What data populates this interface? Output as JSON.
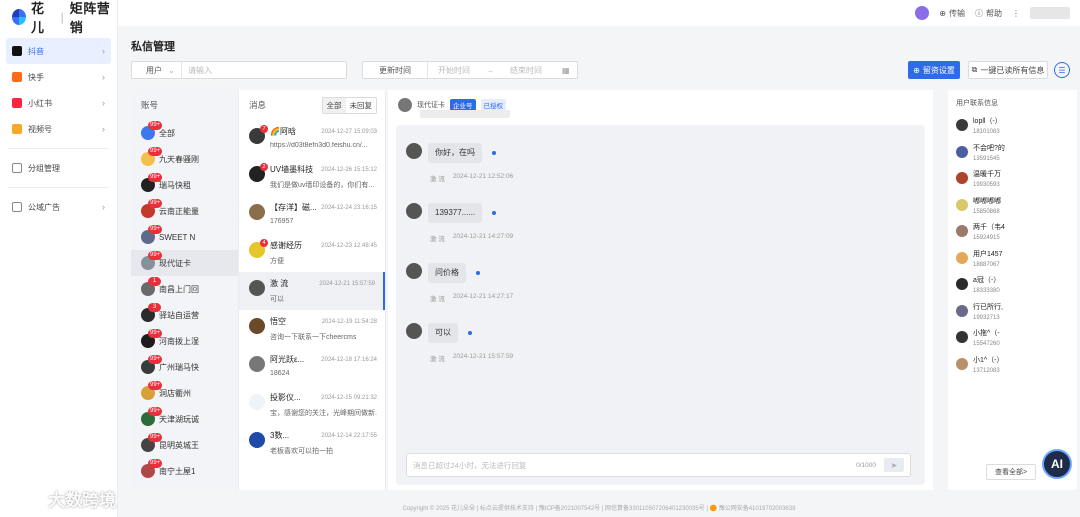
{
  "brand": {
    "name": "花儿",
    "sub": "矩阵营销",
    "logo_icon": "flower-logo-icon"
  },
  "sidebar": {
    "collapse_glyph": "‹",
    "items": [
      {
        "label": "抖音",
        "icon": "douyin-icon",
        "color": "#111111",
        "active": true
      },
      {
        "label": "快手",
        "icon": "kuaishou-icon",
        "color": "#ff6a1a"
      },
      {
        "label": "小红书",
        "icon": "xiaohongshu-icon",
        "color": "#ff2442"
      },
      {
        "label": "视频号",
        "icon": "shipinhao-icon",
        "color": "#f7a826"
      },
      {
        "label": "分组管理",
        "icon": "group-icon",
        "color": "#888888"
      },
      {
        "label": "公域广告",
        "icon": "ad-icon",
        "color": "#888888"
      }
    ]
  },
  "topbar": {
    "transfer": "传输",
    "help": "帮助",
    "more": "⋮"
  },
  "page": {
    "title": "私信管理"
  },
  "filters": {
    "user_select": "用户",
    "user_placeholder": "请输入",
    "date_label": "更新时间",
    "start_placeholder": "开始时间",
    "end_placeholder": "结束时间",
    "arrow": "→"
  },
  "actions": {
    "reply_settings": "留资设置",
    "mark_all_read": "一键已读所有信息",
    "menu_glyph": "☰"
  },
  "accounts": {
    "header": "账号",
    "items": [
      {
        "name": "全部",
        "badge": "99+",
        "color": "#3a78f2"
      },
      {
        "name": "九天春骚刚",
        "badge": "99+",
        "color": "#f3c14b"
      },
      {
        "name": "瑞马快租",
        "badge": "99+",
        "color": "#222222"
      },
      {
        "name": "云南正能量",
        "badge": "99+",
        "color": "#c0392b"
      },
      {
        "name": "SWEET N",
        "badge": "99+",
        "color": "#5b6b8c"
      },
      {
        "name": "现代证卡",
        "badge": "99+",
        "color": "#8a8f99",
        "selected": true
      },
      {
        "name": "南昌上门回",
        "badge": "1",
        "color": "#6a6a6a"
      },
      {
        "name": "驿站自运营",
        "badge": "3",
        "color": "#2b2b2b"
      },
      {
        "name": "河南拨上湿",
        "badge": "99+",
        "color": "#1d1d1d"
      },
      {
        "name": "广州瑞马快",
        "badge": "99+",
        "color": "#3b3b3b"
      },
      {
        "name": "洞店衢州",
        "badge": "99+",
        "color": "#d9a03a"
      },
      {
        "name": "天津湖玩诚",
        "badge": "99+",
        "color": "#2e6b3a"
      },
      {
        "name": "昆明英城王",
        "badge": "99+",
        "color": "#444444"
      },
      {
        "name": "南宁土屋1",
        "badge": "99+",
        "color": "#b04848"
      }
    ]
  },
  "messages": {
    "header": "消息",
    "filter_all": "全部",
    "filter_unreplied": "未回复",
    "items": [
      {
        "name": "🌈阿晗",
        "time": "2024-12-27 15:09:03",
        "preview": "https://d03t8efn3d0.feishu.cn/...",
        "badge": "7",
        "color": "#3a3a3a"
      },
      {
        "name": "UV墙墨科技",
        "time": "2024-12-26 15:15:12",
        "preview": "我们是做uv墙印设备的，你们有...",
        "badge": "2",
        "color": "#222222"
      },
      {
        "name": "【存洋】磁...",
        "time": "2024-12-24 23:16:15",
        "preview": "176957",
        "badge": "",
        "color": "#8a6d4a"
      },
      {
        "name": "感谢经历",
        "time": "2024-12-23 12:48:45",
        "preview": "方便",
        "badge": "4",
        "color": "#e6c62a"
      },
      {
        "name": "激 流",
        "time": "2024-12-21 15:57:59",
        "preview": "可以",
        "badge": "",
        "color": "#555555",
        "selected": true
      },
      {
        "name": "悟空",
        "time": "2024-12-19 11:54:28",
        "preview": "咨询一下联系一下cheercms",
        "badge": "",
        "color": "#6b4a2a"
      },
      {
        "name": "阿光跃ε...",
        "time": "2024-12-18 17:16:24",
        "preview": "18624",
        "badge": "",
        "color": "#777777"
      },
      {
        "name": "投影仪...",
        "time": "2024-12-15 09:21:32",
        "preview": "宝，感谢您的关注，光峰期间做新...",
        "badge": "",
        "color": "#f0f3f8"
      },
      {
        "name": "3数...",
        "time": "2024-12-14 22:17:55",
        "preview": "老板喜欢可以拍一拍",
        "badge": "",
        "color": "#1f4aa8"
      }
    ]
  },
  "chat": {
    "account": "现代证卡",
    "tag_enterprise": "企业号",
    "tag_authorized": "已授权",
    "messages": [
      {
        "text": "你好，在吗",
        "sender": "激 流",
        "time": "2024-12-21 12:52:06"
      },
      {
        "text": "139377......",
        "sender": "激 流",
        "time": "2024-12-21 14:27:09"
      },
      {
        "text": "问价格",
        "sender": "激 流",
        "time": "2024-12-21 14:27:17"
      },
      {
        "text": "可以",
        "sender": "激 流",
        "time": "2024-12-21 15:57:59"
      }
    ],
    "input_placeholder": "消息已超过24小时，无法进行回复",
    "counter": "0/1000",
    "send_icon": "send-icon"
  },
  "contacts": {
    "header": "用户联系信息",
    "items": [
      {
        "name": "lopll（-）",
        "id": "18101083",
        "color": "#3a3a3a"
      },
      {
        "name": "不会吧?的",
        "id": "13591545",
        "color": "#4a5fa0"
      },
      {
        "name": "温暖千万",
        "id": "19930593",
        "color": "#b0432b"
      },
      {
        "name": "嘟嘟嘟嘟",
        "id": "15850868",
        "color": "#d8c86a"
      },
      {
        "name": "两千（韦4",
        "id": "15924915",
        "color": "#9a7a6a"
      },
      {
        "name": "用户1457",
        "id": "18887067",
        "color": "#e5a75a"
      },
      {
        "name": "a冠（-）",
        "id": "18333380",
        "color": "#2a2a2a"
      },
      {
        "name": "行已所行,",
        "id": "19932713",
        "color": "#6a6a8a"
      },
      {
        "name": "小拖^（-",
        "id": "15547260",
        "color": "#333333"
      },
      {
        "name": "小1^（-）",
        "id": "13712083",
        "color": "#b8916a"
      }
    ],
    "view_all": "查看全部>"
  },
  "ai_button": "AI",
  "footer": "Copyright © 2025 花儿朵朵 | 标点云提供技术支持 | 豫ICP备2021007542号 | 网信算备330110507206401230035号 | 🟠 豫公网安备41019702003639",
  "watermark": "大数跨境"
}
